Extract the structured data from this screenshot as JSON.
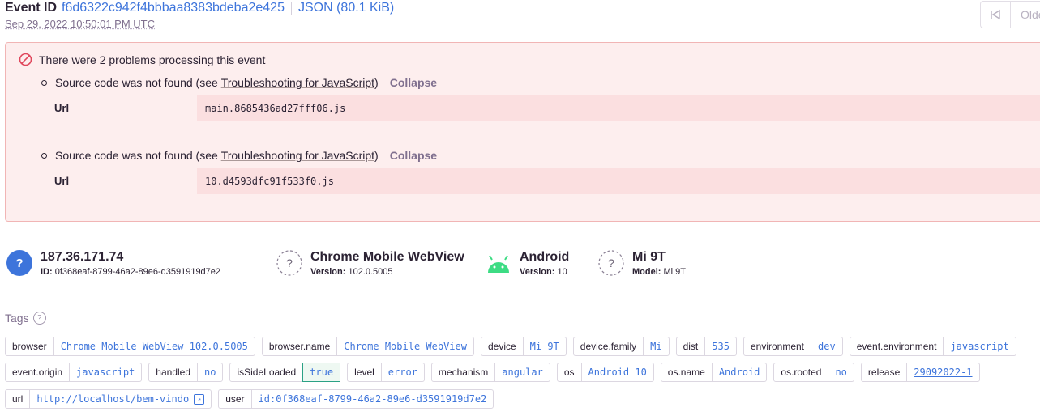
{
  "header": {
    "event_id_label": "Event ID",
    "event_id": "f6d6322c942f4bbbaa8383bdeba2e425",
    "json_link": "JSON (80.1 KiB)",
    "date": "Sep 29, 2022 10:50:01 PM UTC",
    "nav_oldest": "Olde"
  },
  "errors": {
    "title": "There were 2 problems processing this event",
    "items": [
      {
        "prefix": "Source code was not found (see ",
        "link": "Troubleshooting for JavaScript",
        "suffix": ")",
        "collapse": "Collapse",
        "key": "Url",
        "value": "main.8685436ad27fff06.js"
      },
      {
        "prefix": "Source code was not found (see ",
        "link": "Troubleshooting for JavaScript",
        "suffix": ")",
        "collapse": "Collapse",
        "key": "Url",
        "value": "10.d4593dfc91f533f0.js"
      }
    ]
  },
  "context": {
    "user": {
      "title": "187.36.171.74",
      "sub_label": "ID:",
      "sub_value": "0f368eaf-8799-46a2-89e6-d3591919d7e2",
      "icon": "question-icon"
    },
    "browser": {
      "title": "Chrome Mobile WebView",
      "sub_label": "Version:",
      "sub_value": "102.0.5005",
      "icon": "unknown-browser-icon"
    },
    "os": {
      "title": "Android",
      "sub_label": "Version:",
      "sub_value": "10",
      "icon": "android-icon",
      "color": "#3ddc84"
    },
    "device": {
      "title": "Mi 9T",
      "sub_label": "Model:",
      "sub_value": "Mi 9T",
      "icon": "unknown-device-icon"
    }
  },
  "tags": {
    "heading": "Tags",
    "row1": [
      {
        "k": "browser",
        "v": "Chrome Mobile WebView 102.0.5005"
      },
      {
        "k": "browser.name",
        "v": "Chrome Mobile WebView"
      },
      {
        "k": "device",
        "v": "Mi 9T"
      },
      {
        "k": "device.family",
        "v": "Mi"
      },
      {
        "k": "dist",
        "v": "535"
      },
      {
        "k": "environment",
        "v": "dev"
      },
      {
        "k": "event.environment",
        "v": "javascript"
      }
    ],
    "row2": [
      {
        "k": "event.origin",
        "v": "javascript"
      },
      {
        "k": "handled",
        "v": "no"
      },
      {
        "k": "isSideLoaded",
        "v": "true"
      },
      {
        "k": "level",
        "v": "error"
      },
      {
        "k": "mechanism",
        "v": "angular"
      },
      {
        "k": "os",
        "v": "Android 10"
      },
      {
        "k": "os.name",
        "v": "Android"
      },
      {
        "k": "os.rooted",
        "v": "no"
      },
      {
        "k": "release",
        "v": "29092022-1"
      }
    ],
    "row3": [
      {
        "k": "url",
        "v": "http://localhost/bem-vindo"
      },
      {
        "k": "user",
        "v": "id:0f368eaf-8799-46a2-89e6-d3591919d7e2"
      }
    ]
  },
  "colors": {
    "link": "#3d74db",
    "error_bg": "#fdeeee",
    "error_border": "#f1b5b5",
    "android": "#3ddc84",
    "highlight": "#2ba185"
  }
}
